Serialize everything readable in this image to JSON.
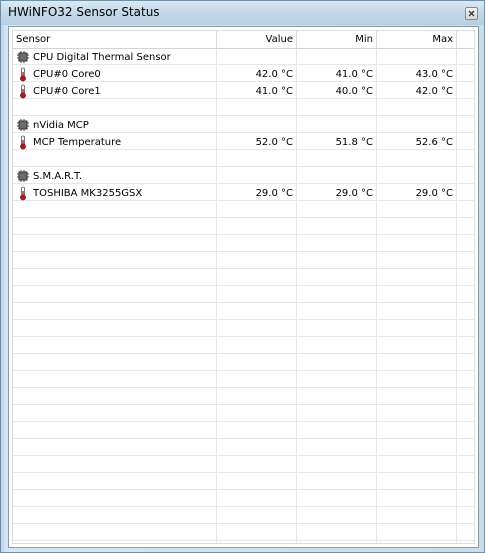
{
  "window": {
    "title": "HWiNFO32 Sensor Status"
  },
  "columns": {
    "sensor": "Sensor",
    "value": "Value",
    "min": "Min",
    "max": "Max"
  },
  "groups": [
    {
      "name": "CPU Digital Thermal Sensor",
      "sensors": [
        {
          "name": "CPU#0 Core0",
          "value": "42.0 °C",
          "min": "41.0 °C",
          "max": "43.0 °C"
        },
        {
          "name": "CPU#0 Core1",
          "value": "41.0 °C",
          "min": "40.0 °C",
          "max": "42.0 °C"
        }
      ]
    },
    {
      "name": "nVidia MCP",
      "sensors": [
        {
          "name": "MCP Temperature",
          "value": "52.0 °C",
          "min": "51.8 °C",
          "max": "52.6 °C"
        }
      ]
    },
    {
      "name": "S.M.A.R.T.",
      "sensors": [
        {
          "name": "TOSHIBA MK3255GSX",
          "value": "29.0 °C",
          "min": "29.0 °C",
          "max": "29.0 °C"
        }
      ]
    }
  ],
  "colors": {
    "thermometer": "#b11a1a",
    "chip": "#555555"
  }
}
